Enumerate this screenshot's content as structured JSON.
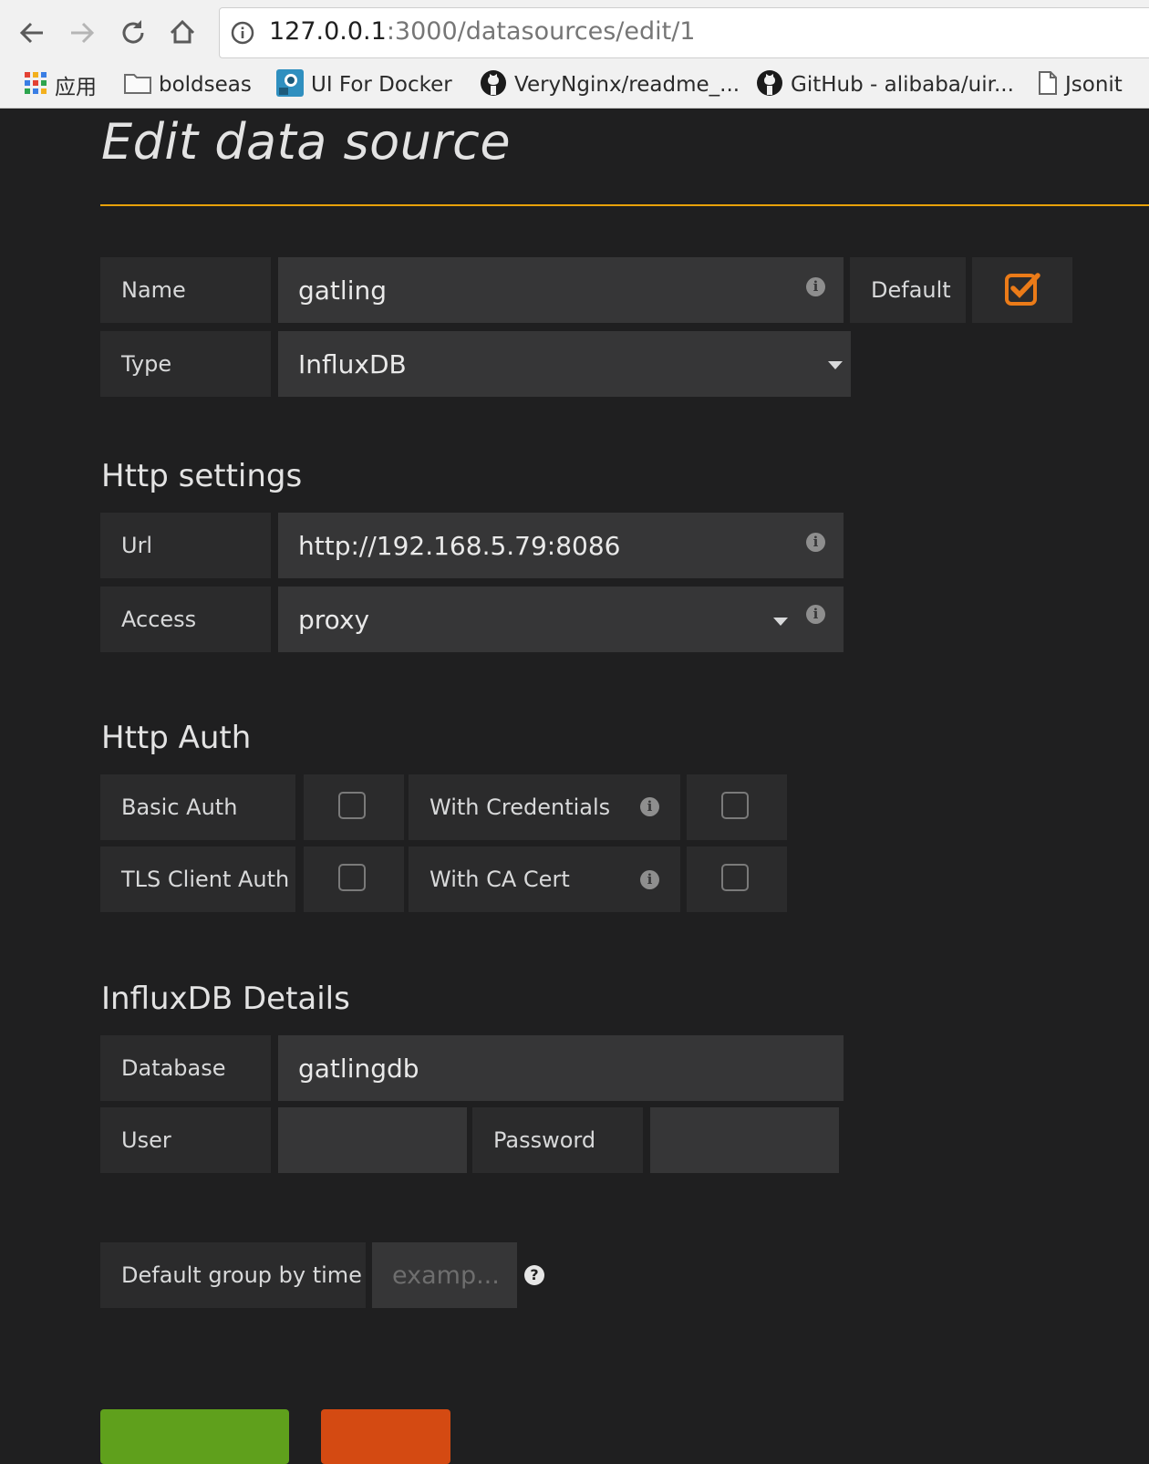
{
  "browser": {
    "url_host": "127.0.0.1",
    "url_path": ":3000/datasources/edit/1",
    "bookmarks": [
      {
        "label": "应用",
        "icon": "apps-grid-icon"
      },
      {
        "label": "boldseas",
        "icon": "folder-icon"
      },
      {
        "label": "UI For Docker",
        "icon": "docker-icon"
      },
      {
        "label": "VeryNginx/readme_...",
        "icon": "github-icon"
      },
      {
        "label": "GitHub - alibaba/uir...",
        "icon": "github-icon"
      },
      {
        "label": "Jsonit",
        "icon": "page-icon"
      }
    ]
  },
  "page": {
    "title": "Edit data source",
    "accent_color": "#e7a10a"
  },
  "general": {
    "name_label": "Name",
    "name_value": "gatling",
    "default_label": "Default",
    "default_checked": true,
    "type_label": "Type",
    "type_value": "InfluxDB"
  },
  "http_settings": {
    "heading": "Http settings",
    "url_label": "Url",
    "url_value": "http://192.168.5.79:8086",
    "access_label": "Access",
    "access_value": "proxy"
  },
  "http_auth": {
    "heading": "Http Auth",
    "basic_auth_label": "Basic Auth",
    "with_credentials_label": "With Credentials",
    "tls_client_auth_label": "TLS Client Auth",
    "with_ca_cert_label": "With CA Cert"
  },
  "influx": {
    "heading": "InfluxDB Details",
    "database_label": "Database",
    "database_value": "gatlingdb",
    "user_label": "User",
    "user_value": "",
    "password_label": "Password",
    "password_value": ""
  },
  "group_by": {
    "label": "Default group by time",
    "placeholder": "examp..."
  },
  "buttons": {
    "save_color": "#5fa01c",
    "delete_color": "#d44a12"
  }
}
